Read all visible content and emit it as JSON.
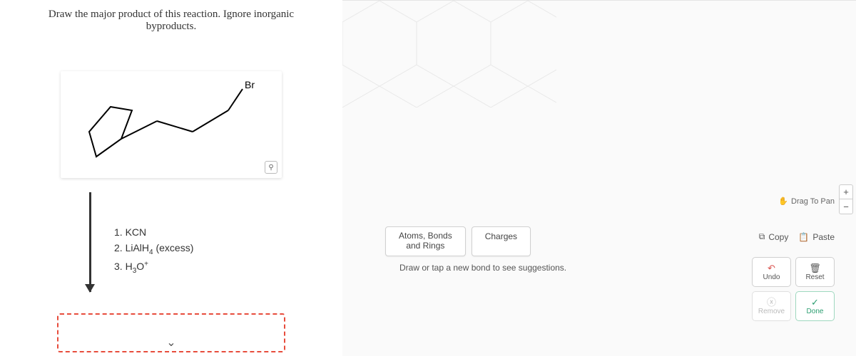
{
  "prompt": {
    "line1": "Draw the major product of this reaction. Ignore inorganic",
    "line2": "byproducts."
  },
  "molecule": {
    "atom_label": "Br",
    "mag_icon": "⚲"
  },
  "reagents": {
    "step1": "1. KCN",
    "step2_prefix": "2. LiAlH",
    "step2_sub": "4",
    "step2_suffix": " (excess)",
    "step3_prefix": "3. H",
    "step3_sub": "3",
    "step3_mid": "O",
    "step3_sup": "+"
  },
  "collapse_icon": "⌄",
  "canvas": {
    "drag_label": "Drag To Pan",
    "drag_icon": "✋",
    "zoom_in": "+",
    "zoom_out": "−",
    "tabs": {
      "atoms_l1": "Atoms, Bonds",
      "atoms_l2": "and Rings",
      "charges": "Charges"
    },
    "hint": "Draw or tap a new bond to see suggestions.",
    "copy_label": "Copy",
    "copy_icon": "⧉",
    "paste_label": "Paste",
    "paste_icon": "📋",
    "actions": {
      "undo": "Undo",
      "undo_icon": "↶",
      "reset": "Reset",
      "reset_icon": "🗑",
      "remove": "Remove",
      "remove_icon": "ⓧ",
      "done": "Done",
      "done_icon": "✓"
    }
  }
}
